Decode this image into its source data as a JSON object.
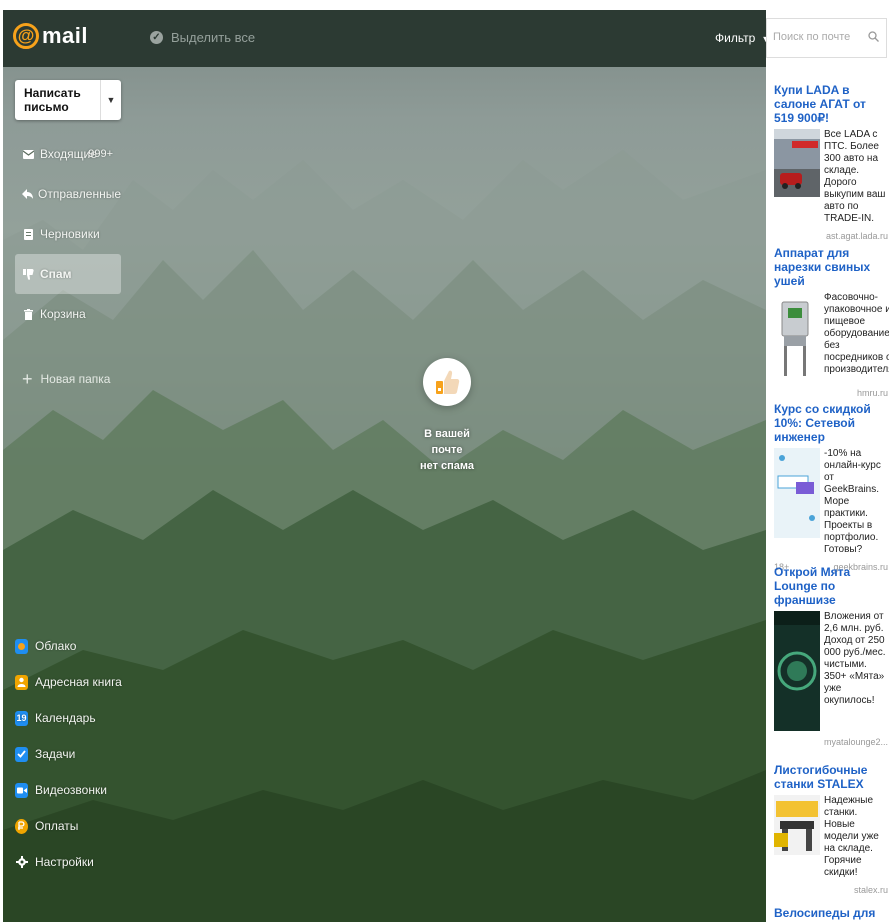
{
  "header": {
    "logo_text": "mail",
    "select_all_label": "Выделить все",
    "filter_label": "Фильтр"
  },
  "search": {
    "placeholder": "Поиск по почте"
  },
  "compose": {
    "label": "Написать письмо"
  },
  "folders": [
    {
      "label": "Входящие",
      "count": "999+",
      "icon": "envelope-icon"
    },
    {
      "label": "Отправленные",
      "icon": "reply-icon"
    },
    {
      "label": "Черновики",
      "icon": "draft-icon"
    },
    {
      "label": "Спам",
      "icon": "thumbs-down-icon",
      "active": true
    },
    {
      "label": "Корзина",
      "icon": "trash-icon"
    }
  ],
  "new_folder_label": "Новая папка",
  "apps": [
    {
      "label": "Облако",
      "icon": "cloud-icon",
      "color": "#1f8ef1"
    },
    {
      "label": "Адресная книга",
      "icon": "contacts-icon",
      "color": "#f0a500"
    },
    {
      "label": "Календарь",
      "icon": "calendar-icon",
      "color": "#1f8ef1",
      "glyph": "19"
    },
    {
      "label": "Задачи",
      "icon": "tasks-icon",
      "color": "#1f8ef1"
    },
    {
      "label": "Видеозвонки",
      "icon": "video-icon",
      "color": "#1f8ef1"
    },
    {
      "label": "Оплаты",
      "icon": "payments-icon",
      "color": "#f0a500"
    },
    {
      "label": "Настройки",
      "icon": "gear-icon",
      "color": "#ffffff"
    }
  ],
  "empty_state": {
    "message_line1": "В вашей почте",
    "message_line2": "нет спама"
  },
  "ads": [
    {
      "title": "Купи LADA в салоне АГАТ от 519 900₽!",
      "text": "Все LADA с ПТС. Более 300 авто на складе. Дорого выкупим ваш авто по TRADE-IN.",
      "domain": "ast.agat.lada.ru"
    },
    {
      "title": "Аппарат для нарезки свиных ушей",
      "text": "Фасовочно-упаковочное и пищевое оборудование без посредников от производителя.",
      "domain": "hmru.ru"
    },
    {
      "title": "Курс со скидкой 10%: Сетевой инженер",
      "text": "-10% на онлайн-курс от GeekBrains. Море практики. Проекты в портфолио. Готовы?",
      "domain": "geekbrains.ru",
      "age": "18+"
    },
    {
      "title": "Открой Мята Lounge по франшизе",
      "text": "Вложения от 2,6 млн. руб. Доход от 250 000 руб./мес. чистыми. 350+ «Мята» уже окупилось!",
      "domain": "myatalounge2..."
    },
    {
      "title": "Листогибочные станки STALEX",
      "text": "Надежные станки. Новые модели уже на складе. Горячие скидки!",
      "domain": "stalex.ru"
    },
    {
      "title": "Велосипеды для детей и"
    }
  ]
}
